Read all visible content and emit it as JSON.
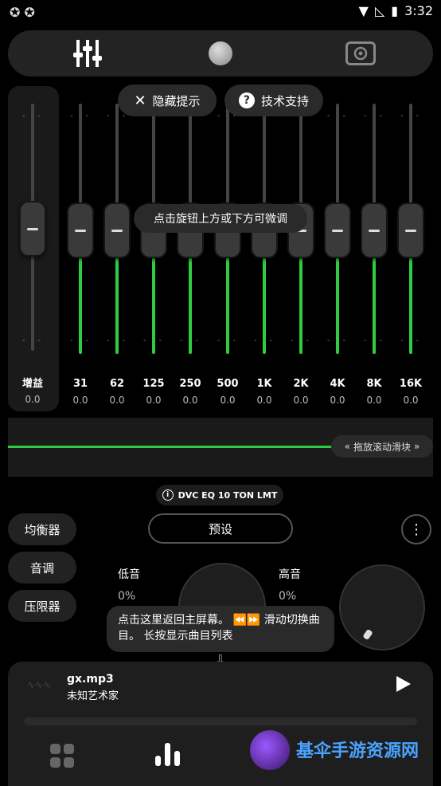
{
  "status_bar": {
    "time": "3:32"
  },
  "nav": {
    "tabs": [
      "equalizer",
      "knob",
      "speaker"
    ]
  },
  "hints": {
    "hide_hints": "隐藏提示",
    "tech_support": "技术支持",
    "fine_tune": "点击旋钮上方或下方可微调",
    "drag_slider": "拖放滚动滑块",
    "return_home": "点击这里返回主屏幕。 ⏪⏩ 滑动切换曲目。 长按显示曲目列表"
  },
  "gain": {
    "label": "增益",
    "value": "0.0"
  },
  "bands": [
    {
      "label": "31",
      "value": "0.0"
    },
    {
      "label": "62",
      "value": "0.0"
    },
    {
      "label": "125",
      "value": "0.0"
    },
    {
      "label": "250",
      "value": "0.0"
    },
    {
      "label": "500",
      "value": "0.0"
    },
    {
      "label": "1K",
      "value": "0.0"
    },
    {
      "label": "2K",
      "value": "0.0"
    },
    {
      "label": "4K",
      "value": "0.0"
    },
    {
      "label": "8K",
      "value": "0.0"
    },
    {
      "label": "16K",
      "value": "0.0"
    }
  ],
  "dvc_label": "DVC EQ 10 TON LMT",
  "side_buttons": {
    "equalizer": "均衡器",
    "tone": "音调",
    "limiter": "压限器"
  },
  "preset_label": "预设",
  "tone": {
    "bass_label": "低音",
    "bass_value": "0%",
    "treble_label": "高音",
    "treble_value": "0%"
  },
  "player": {
    "track": "gx.mp3",
    "artist": "未知艺术家"
  },
  "watermark": {
    "text": "基伞手游资源网"
  },
  "colors": {
    "accent": "#2ecc40",
    "panel": "#1a1a1a"
  }
}
